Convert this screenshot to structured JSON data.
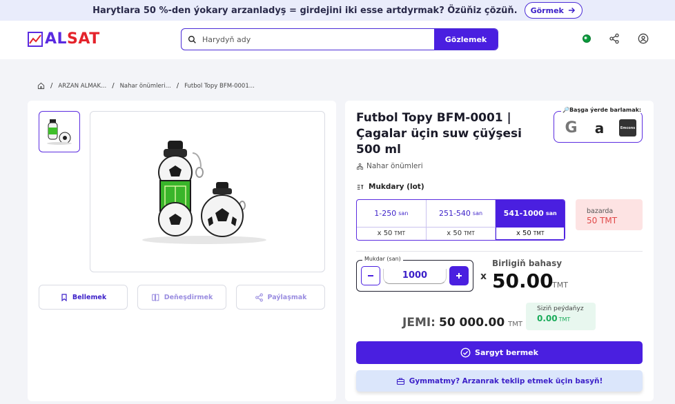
{
  "banner": {
    "text": "Harytlara 50 %-den ýokary arzanladyş = girdejini iki esse artdyrmak? Özüňiz çözüň.",
    "button_label": "Görmek"
  },
  "header": {
    "logo_part1": "AL",
    "logo_part2": "SAT",
    "search_placeholder": "Harydyň ady",
    "search_button": "Gözlemek"
  },
  "breadcrumb": [
    "ARZAN ALMAK...",
    "Nahar önümleri...",
    "Futbol Topy BFM-0001..."
  ],
  "product": {
    "title": "Futbol Topy BFM-0001 | Çagalar üçin suw çüýşesi 500 ml",
    "category": "Nahar önümleri",
    "elsewhere_label": "🔎Başga ýerde barlamak:",
    "marketplaces": [
      "G",
      "a",
      "Emcons"
    ]
  },
  "actions": {
    "bookmark": "Bellemek",
    "compare": "Deňeşdirmek",
    "share": "Paýlaşmak"
  },
  "pricing": {
    "qty_label": "Mukdary (lot)",
    "tiers": [
      {
        "range": "1-250",
        "unit": "san",
        "mult": "x 50",
        "cur": "TMT"
      },
      {
        "range": "251-540",
        "unit": "san",
        "mult": "x 50",
        "cur": "TMT"
      },
      {
        "range": "541-1000",
        "unit": "san",
        "mult": "x 50",
        "cur": "TMT"
      }
    ],
    "market_label": "bazarda",
    "market_price": "50 TMT",
    "qty_box_label": "Mukdar (san)",
    "qty_value": "1000",
    "times": "x",
    "unit_price_label": "Birligiň bahasy",
    "unit_price": "50.00",
    "currency": "TMT",
    "total_label": "JEMI:",
    "total_value": "50 000.00",
    "profit_label": "Siziň peýdaňyz",
    "profit_value": "0.00",
    "order_button": "Sargyt bermek",
    "offer_button": "Gymmatmy? Arzanrak teklip etmek üçin basyň!"
  },
  "colors": {
    "accent": "#4a1fe0",
    "brand_red": "#e4232b",
    "market_bg": "#fde3e3",
    "profit_green": "#1aab5a"
  }
}
